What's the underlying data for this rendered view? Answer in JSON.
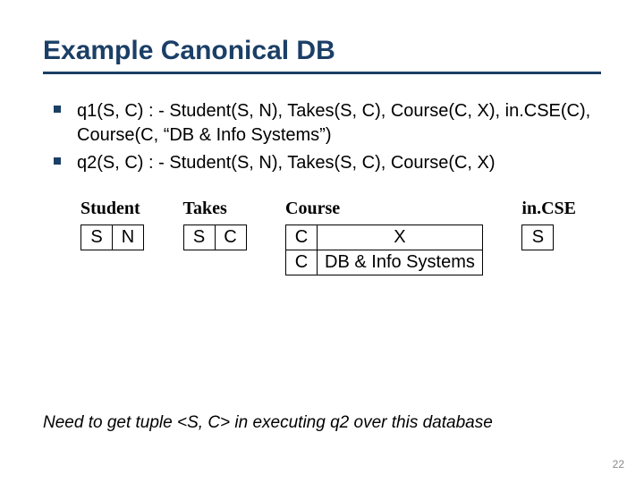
{
  "title": "Example Canonical DB",
  "bullets": [
    "q1(S, C) : - Student(S, N), Takes(S, C), Course(C, X), in.CSE(C), Course(C, “DB & Info Systems”)",
    "q2(S, C) : - Student(S, N), Takes(S, C), Course(C, X)"
  ],
  "tables": {
    "student": {
      "name": "Student",
      "rows": [
        [
          "S",
          "N"
        ]
      ]
    },
    "takes": {
      "name": "Takes",
      "rows": [
        [
          "S",
          "C"
        ]
      ]
    },
    "course": {
      "name": "Course",
      "rows": [
        [
          "C",
          "X"
        ],
        [
          "C",
          "DB & Info Systems"
        ]
      ]
    },
    "incse": {
      "name": "in.CSE",
      "rows": [
        [
          "S"
        ]
      ]
    }
  },
  "footer": "Need to get  tuple <S, C> in executing q2 over this database",
  "page_number": "22"
}
